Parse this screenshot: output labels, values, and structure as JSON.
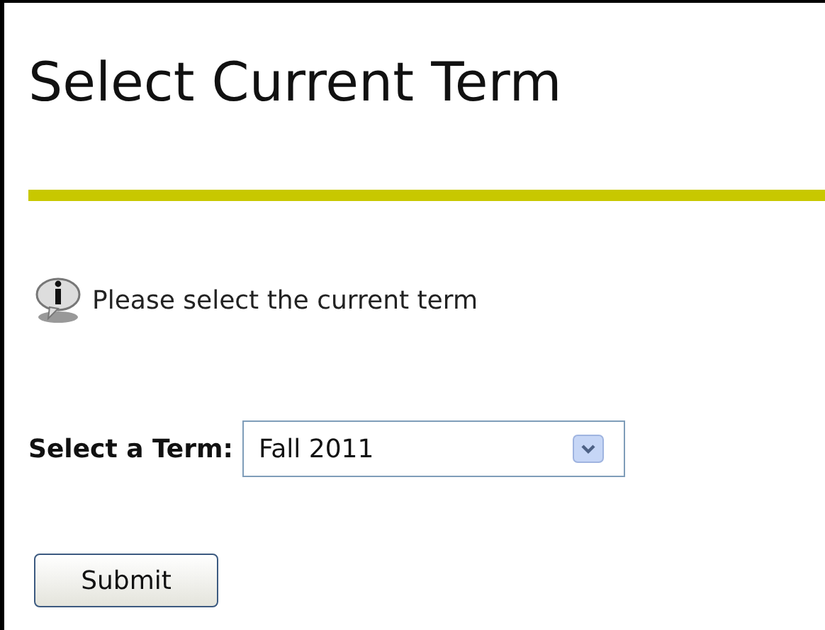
{
  "heading": "Select Current Term",
  "info": "Please select the current term",
  "term_field": {
    "label": "Select a Term:",
    "value": "Fall 2011"
  },
  "submit": "Submit"
}
